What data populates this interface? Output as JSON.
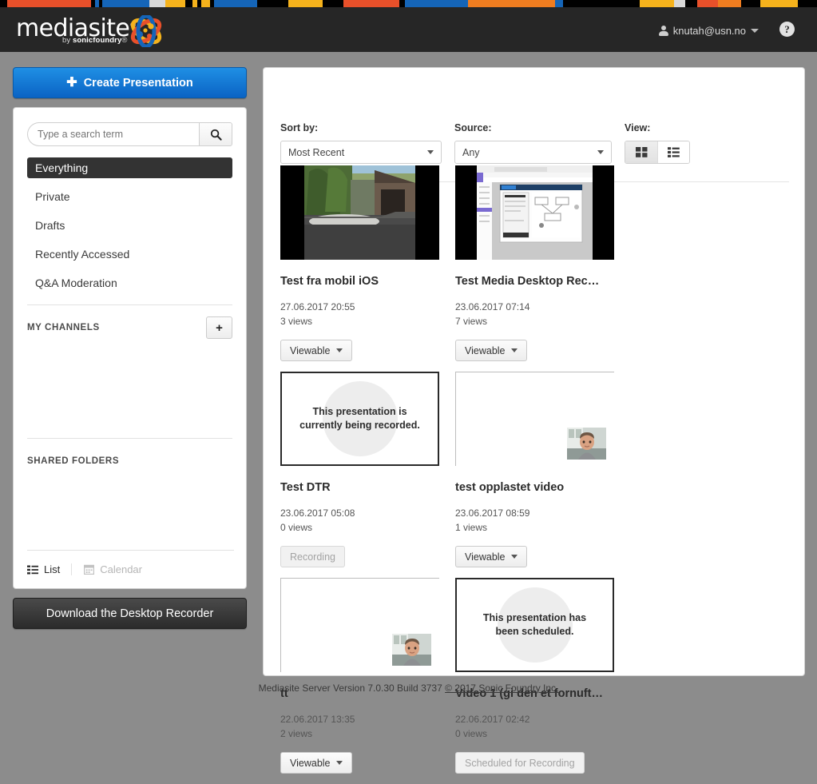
{
  "colorbar": [
    {
      "color": "#000000",
      "w": 12
    },
    {
      "color": "#e8502a",
      "w": 133
    },
    {
      "color": "#000000",
      "w": 6
    },
    {
      "color": "#1565b8",
      "w": 6
    },
    {
      "color": "#000000",
      "w": 5
    },
    {
      "color": "#1565b8",
      "w": 75
    },
    {
      "color": "#d8d8d8",
      "w": 25
    },
    {
      "color": "#f5b21c",
      "w": 32
    },
    {
      "color": "#000000",
      "w": 12
    },
    {
      "color": "#f5b21c",
      "w": 8
    },
    {
      "color": "#000000",
      "w": 6
    },
    {
      "color": "#f5b21c",
      "w": 14
    },
    {
      "color": "#000000",
      "w": 6
    },
    {
      "color": "#1565b8",
      "w": 68
    },
    {
      "color": "#000000",
      "w": 50
    },
    {
      "color": "#f5b21c",
      "w": 55
    },
    {
      "color": "#000000",
      "w": 33
    },
    {
      "color": "#e8502a",
      "w": 88
    },
    {
      "color": "#000000",
      "w": 9
    },
    {
      "color": "#1565b8",
      "w": 101
    },
    {
      "color": "#f07d20",
      "w": 138
    },
    {
      "color": "#1565b8",
      "w": 12
    },
    {
      "color": "#000000",
      "w": 122
    },
    {
      "color": "#f5b21c",
      "w": 55
    },
    {
      "color": "#d8d8d8",
      "w": 18
    },
    {
      "color": "#000000",
      "w": 18
    },
    {
      "color": "#e8502a",
      "w": 33
    },
    {
      "color": "#f07d20",
      "w": 38
    },
    {
      "color": "#000000",
      "w": 30
    },
    {
      "color": "#f5b21c",
      "w": 60
    },
    {
      "color": "#000000",
      "w": 30
    }
  ],
  "header": {
    "logo_text": "mediasite",
    "logo_registered": "®",
    "logo_sub_prefix": "by ",
    "logo_sub_brand": "sonicfoundry",
    "logo_sub_suffix": "®",
    "user_email": "knutah@usn.no",
    "help_label": "?"
  },
  "sidebar": {
    "create_button": "Create Presentation",
    "create_icon": "plus-icon",
    "search_placeholder": "Type a search term",
    "search_value": "",
    "search_icon": "search-icon",
    "nav_items": [
      {
        "label": "Everything",
        "active": true
      },
      {
        "label": "Private",
        "active": false
      },
      {
        "label": "Drafts",
        "active": false
      },
      {
        "label": "Recently Accessed",
        "active": false
      },
      {
        "label": "Q&A Moderation",
        "active": false
      }
    ],
    "my_channels_title": "MY CHANNELS",
    "add_channel_label": "+",
    "shared_folders_title": "SHARED FOLDERS",
    "list_label": "List",
    "calendar_label": "Calendar",
    "download_button": "Download the Desktop Recorder"
  },
  "toolbar": {
    "sort_label": "Sort by:",
    "sort_value": "Most Recent",
    "source_label": "Source:",
    "source_value": "Any",
    "view_label": "View:",
    "view_grid_icon": "grid-view-icon",
    "view_list_icon": "list-view-icon",
    "view_active": "grid"
  },
  "presentations": [
    {
      "title": "Test fra mobil iOS",
      "date": "27.06.2017 20:55",
      "views": "3 views",
      "status": "Viewable",
      "status_type": "dropdown",
      "thumb": "video-outdoor"
    },
    {
      "title": "Test Media Desktop Rec…",
      "date": "23.06.2017 07:14",
      "views": "7 views",
      "status": "Viewable",
      "status_type": "dropdown",
      "thumb": "video-screencast"
    },
    {
      "title": "Test DTR",
      "date": "23.06.2017 05:08",
      "views": "0 views",
      "status": "Recording",
      "status_type": "disabled",
      "thumb": "placeholder",
      "placeholder_text": "This presentation is currently being recorded."
    },
    {
      "title": "test opplastet video",
      "date": "23.06.2017 08:59",
      "views": "1 views",
      "status": "Viewable",
      "status_type": "dropdown",
      "thumb": "blank-webcam"
    },
    {
      "title": "tt",
      "date": "22.06.2017 13:35",
      "views": "2 views",
      "status": "Viewable",
      "status_type": "dropdown",
      "thumb": "blank-webcam"
    },
    {
      "title": "Video 1 (gi den et fornuft…",
      "date": "22.06.2017 02:42",
      "views": "0 views",
      "status": "Scheduled for Recording",
      "status_type": "disabled",
      "thumb": "placeholder",
      "placeholder_text": "This presentation has been scheduled."
    }
  ],
  "footer": {
    "version_text": "Mediasite Server Version 7.0.30 Build 3737",
    "copyright_link": "© 2017 Sonic Foundry Inc."
  }
}
